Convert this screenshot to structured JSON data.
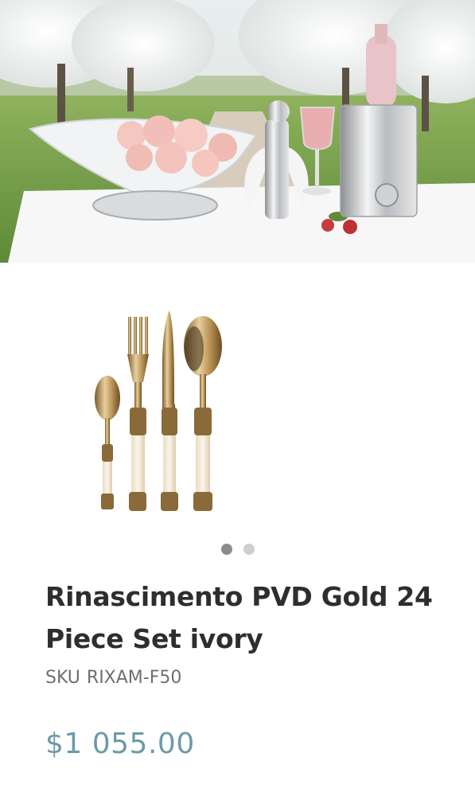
{
  "product": {
    "title": "Rinascimento PVD Gold 24 Piece Set ivory",
    "sku_label": "SKU",
    "sku": "RIXAM-F50",
    "price": "$1 055.00"
  },
  "gallery": {
    "slide_count": 2,
    "active_slide": 1
  },
  "hero": {
    "image": "outdoor-table-setting-photo"
  }
}
